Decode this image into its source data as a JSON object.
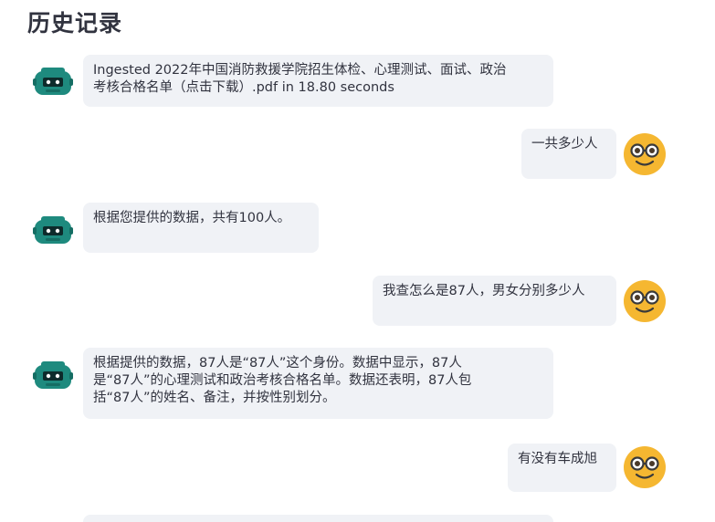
{
  "page": {
    "title": "历史记录"
  },
  "colors": {
    "bubble_bg": "#f0f2f6",
    "text": "#31333f",
    "bot_avatar": "#1e8a7e",
    "user_avatar": "#f5b731"
  },
  "messages": [
    {
      "role": "assistant",
      "avatar_icon": "robot-icon",
      "text": "Ingested 2022年中国消防救援学院招生体检、心理测试、面试、政治\n考核合格名单（点击下载）.pdf in 18.80 seconds"
    },
    {
      "role": "user",
      "avatar_icon": "nerd-face-icon",
      "text": "一共多少人"
    },
    {
      "role": "assistant",
      "avatar_icon": "robot-icon",
      "text": "根据您提供的数据，共有100人。"
    },
    {
      "role": "user",
      "avatar_icon": "nerd-face-icon",
      "text": "我查怎么是87人，男女分别多少人"
    },
    {
      "role": "assistant",
      "avatar_icon": "robot-icon",
      "text": "根据提供的数据，87人是“87人”这个身份。数据中显示，87人\n是“87人”的心理测试和政治考核合格名单。数据还表明，87人包\n括“87人”的姓名、备注，并按性别划分。"
    },
    {
      "role": "user",
      "avatar_icon": "nerd-face-icon",
      "text": "有没有车成旭"
    }
  ]
}
